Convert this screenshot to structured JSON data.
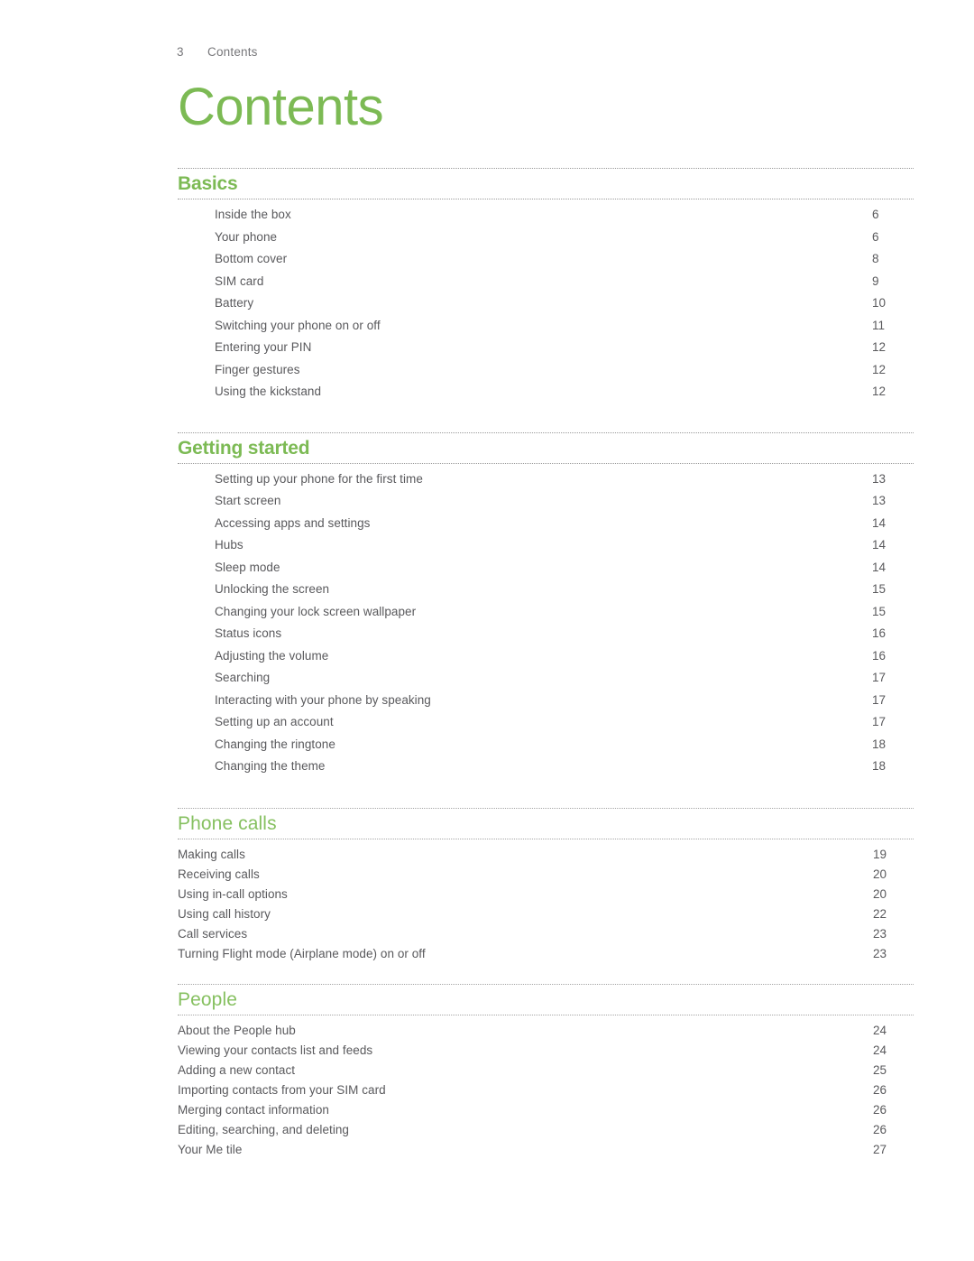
{
  "header": {
    "folio": "3",
    "title": "Contents"
  },
  "page_title": "Contents",
  "colors": {
    "heading_green": "#7cba54",
    "heading_green_light": "#86c060",
    "body_gray": "#59595c",
    "header_gray": "#77777a",
    "rule_gray": "#9a9a9a"
  },
  "sections": [
    {
      "heading": "Basics",
      "entries": [
        {
          "label": "Inside the box",
          "page": "6"
        },
        {
          "label": "Your phone",
          "page": "6"
        },
        {
          "label": "Bottom cover",
          "page": "8"
        },
        {
          "label": "SIM card",
          "page": "9"
        },
        {
          "label": "Battery",
          "page": "10"
        },
        {
          "label": "Switching your phone on or off",
          "page": "11"
        },
        {
          "label": "Entering your PIN",
          "page": "12"
        },
        {
          "label": "Finger gestures",
          "page": "12"
        },
        {
          "label": "Using the kickstand",
          "page": "12"
        }
      ]
    },
    {
      "heading": "Getting started",
      "entries": [
        {
          "label": "Setting up your phone for the first time",
          "page": "13"
        },
        {
          "label": "Start screen",
          "page": "13"
        },
        {
          "label": "Accessing apps and settings",
          "page": "14"
        },
        {
          "label": "Hubs",
          "page": "14"
        },
        {
          "label": "Sleep mode",
          "page": "14"
        },
        {
          "label": "Unlocking the screen",
          "page": "15"
        },
        {
          "label": "Changing your lock screen wallpaper",
          "page": "15"
        },
        {
          "label": "Status icons",
          "page": "16"
        },
        {
          "label": "Adjusting the volume",
          "page": "16"
        },
        {
          "label": "Searching",
          "page": "17"
        },
        {
          "label": "Interacting with your phone by speaking",
          "page": "17"
        },
        {
          "label": "Setting up an account",
          "page": "17"
        },
        {
          "label": "Changing the ringtone",
          "page": "18"
        },
        {
          "label": "Changing the theme",
          "page": "18"
        }
      ]
    },
    {
      "heading": "Phone calls",
      "entries": [
        {
          "label": "Making calls",
          "page": "19"
        },
        {
          "label": "Receiving calls",
          "page": "20"
        },
        {
          "label": "Using in-call options",
          "page": "20"
        },
        {
          "label": "Using call history",
          "page": "22"
        },
        {
          "label": "Call services",
          "page": "23"
        },
        {
          "label": "Turning Flight mode (Airplane mode) on or off",
          "page": "23"
        }
      ]
    },
    {
      "heading": "People",
      "entries": [
        {
          "label": "About the People hub",
          "page": "24"
        },
        {
          "label": "Viewing your contacts list and feeds",
          "page": "24"
        },
        {
          "label": "Adding a new contact",
          "page": "25"
        },
        {
          "label": "Importing contacts from your SIM card",
          "page": "26"
        },
        {
          "label": "Merging contact information",
          "page": "26"
        },
        {
          "label": "Editing, searching, and deleting",
          "page": "26"
        },
        {
          "label": "Your Me tile",
          "page": "27"
        }
      ]
    }
  ]
}
